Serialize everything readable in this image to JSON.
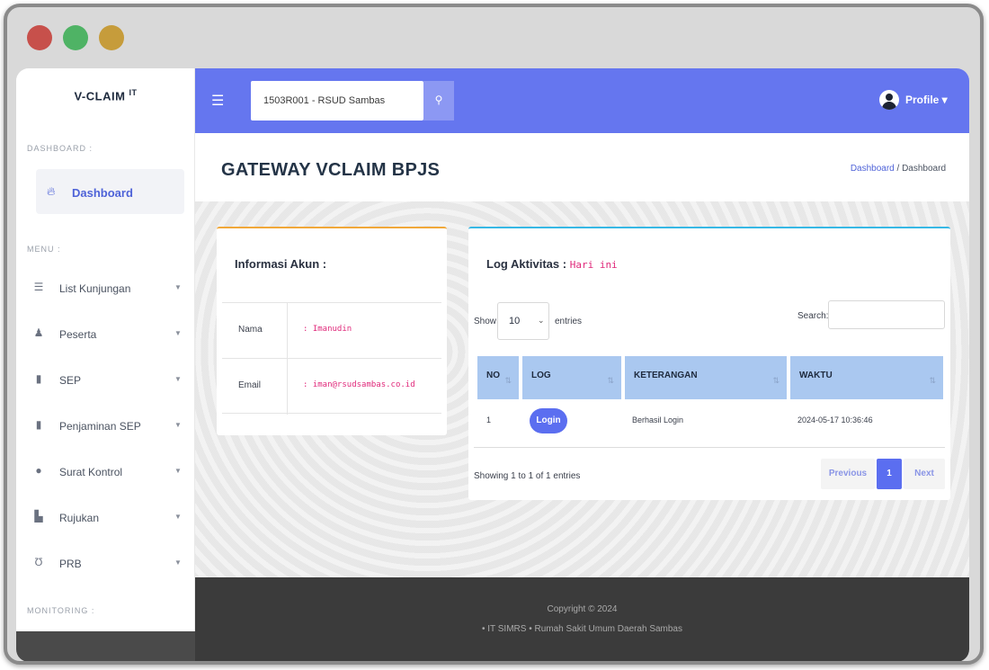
{
  "window": {
    "controls": [
      "close",
      "minimize",
      "maximize"
    ]
  },
  "sidebar": {
    "brand": "V-CLAIM",
    "brand_sup": "IT",
    "section_dashboard": "DASHBOARD :",
    "dashboard_item": {
      "label": "Dashboard",
      "icon": "fire-icon"
    },
    "section_menu": "MENU :",
    "items": [
      {
        "label": "List Kunjungan",
        "icon": "list-icon",
        "glyph": "☰"
      },
      {
        "label": "Peserta",
        "icon": "user-icon",
        "glyph": "♟"
      },
      {
        "label": "SEP",
        "icon": "file-icon",
        "glyph": "▮"
      },
      {
        "label": "Penjaminan SEP",
        "icon": "file-icon",
        "glyph": "▮"
      },
      {
        "label": "Surat Kontrol",
        "icon": "clock-icon",
        "glyph": "●"
      },
      {
        "label": "Rujukan",
        "icon": "building-icon",
        "glyph": "▙"
      },
      {
        "label": "PRB",
        "icon": "stethoscope-icon",
        "glyph": "Ʊ"
      }
    ],
    "section_monitoring": "MONITORING :"
  },
  "topbar": {
    "menu_icon": "☰",
    "search_value": "1503R001 - RSUD Sambas",
    "search_icon": "🔍",
    "profile_label": "Profile ▾"
  },
  "header": {
    "title": "GATEWAY VCLAIM BPJS",
    "breadcrumb_link": "Dashboard",
    "breadcrumb_sep": " / ",
    "breadcrumb_current": "Dashboard"
  },
  "info_card": {
    "title": "Informasi Akun :",
    "rows": [
      {
        "key": "Nama",
        "value": "Imanudin"
      },
      {
        "key": "Email",
        "value": "iman@rsudsambas.co.id"
      }
    ]
  },
  "log_card": {
    "title": "Log Aktivitas : ",
    "title_mono": "Hari ini",
    "show_label": "Show",
    "show_value": "10",
    "entries_label": "entries",
    "search_label": "Search:",
    "columns": [
      "NO",
      "LOG",
      "KETERANGAN",
      "WAKTU"
    ],
    "rows": [
      {
        "no": "1",
        "log": "Login",
        "keterangan": "Berhasil Login",
        "waktu": "2024-05-17 10:36:46"
      }
    ],
    "showing_text": "Showing 1 to 1 of 1 entries",
    "pager": {
      "previous": "Previous",
      "current": "1",
      "next": "Next"
    }
  },
  "footer": {
    "line1": "Copyright © 2024",
    "line2": "• IT SIMRS • Rumah Sakit Umum Daerah Sambas"
  },
  "colors": {
    "topbar": "#6576ef",
    "accent": "#4f63d8",
    "info_border": "#f1a83a",
    "log_border": "#37b8e5",
    "header_row": "#aac8f0",
    "footer": "#3b3b3b"
  }
}
